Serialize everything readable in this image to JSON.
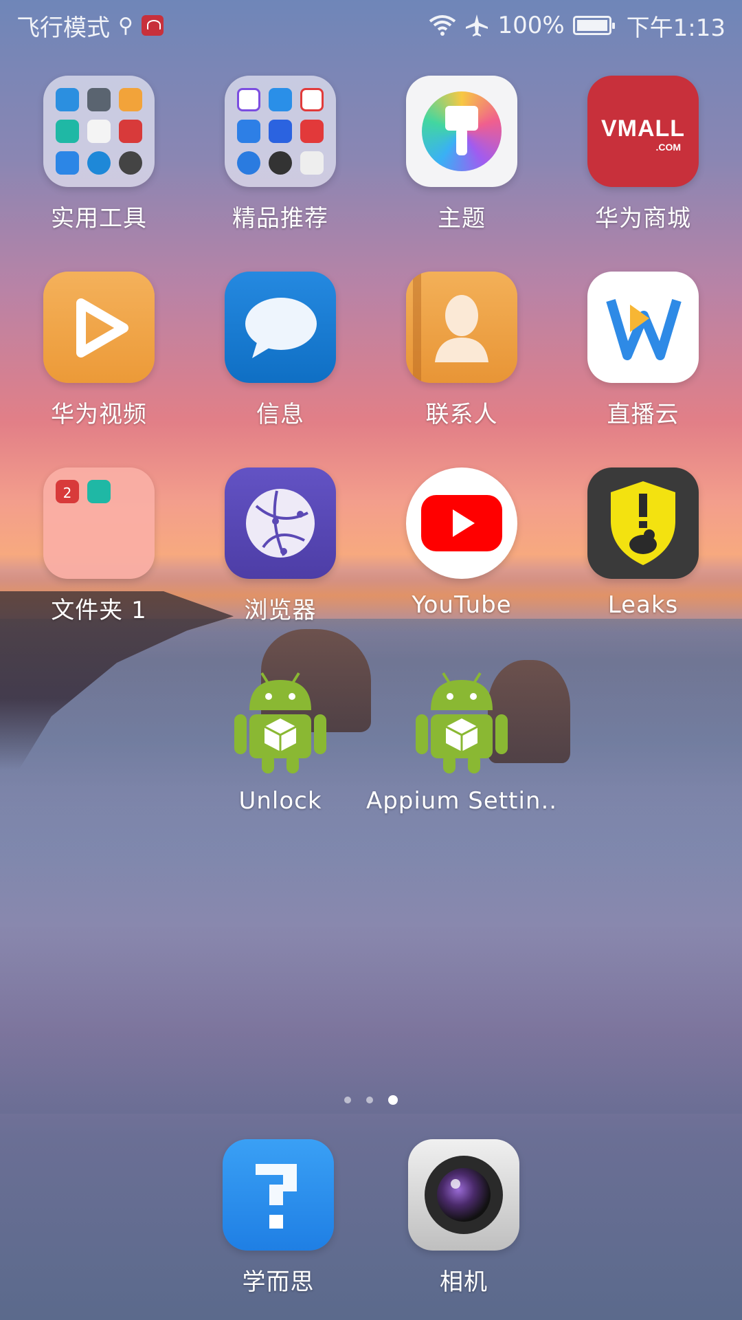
{
  "status_bar": {
    "mode": "飞行模式",
    "battery": "100%",
    "time": "下午1:13"
  },
  "apps": [
    {
      "label": "实用工具",
      "icon": "folder-tools-icon"
    },
    {
      "label": "精品推荐",
      "icon": "folder-recommended-icon"
    },
    {
      "label": "主题",
      "icon": "themes-icon"
    },
    {
      "label": "华为商城",
      "icon": "vmall-icon",
      "icon_text": "VMALL",
      "icon_subtext": ".COM"
    },
    {
      "label": "华为视频",
      "icon": "huawei-video-icon"
    },
    {
      "label": "信息",
      "icon": "messages-icon"
    },
    {
      "label": "联系人",
      "icon": "contacts-icon"
    },
    {
      "label": "直播云",
      "icon": "live-cloud-icon"
    },
    {
      "label": "文件夹 1",
      "icon": "folder-icon",
      "calendar_day": "2"
    },
    {
      "label": "浏览器",
      "icon": "browser-icon"
    },
    {
      "label": "YouTube",
      "icon": "youtube-icon"
    },
    {
      "label": "Leaks",
      "icon": "leaks-icon"
    },
    {
      "label": "Unlock",
      "icon": "android-icon"
    },
    {
      "label": "Appium Settin..",
      "icon": "android-icon"
    }
  ],
  "dock": [
    {
      "label": "学而思",
      "icon": "xueersi-icon"
    },
    {
      "label": "相机",
      "icon": "camera-icon"
    }
  ],
  "page_indicator": {
    "pages": 3,
    "current": 3
  },
  "colors": {
    "vmall": "#c8303b",
    "video": "#f0a13e",
    "messages": "#1a7fd4",
    "contacts": "#f0a13e",
    "browser": "#5b49b5",
    "youtube": "#ff0000",
    "leaks_bg": "#3a3a3a",
    "leaks_shield": "#f3e210",
    "android": "#8ab833"
  }
}
